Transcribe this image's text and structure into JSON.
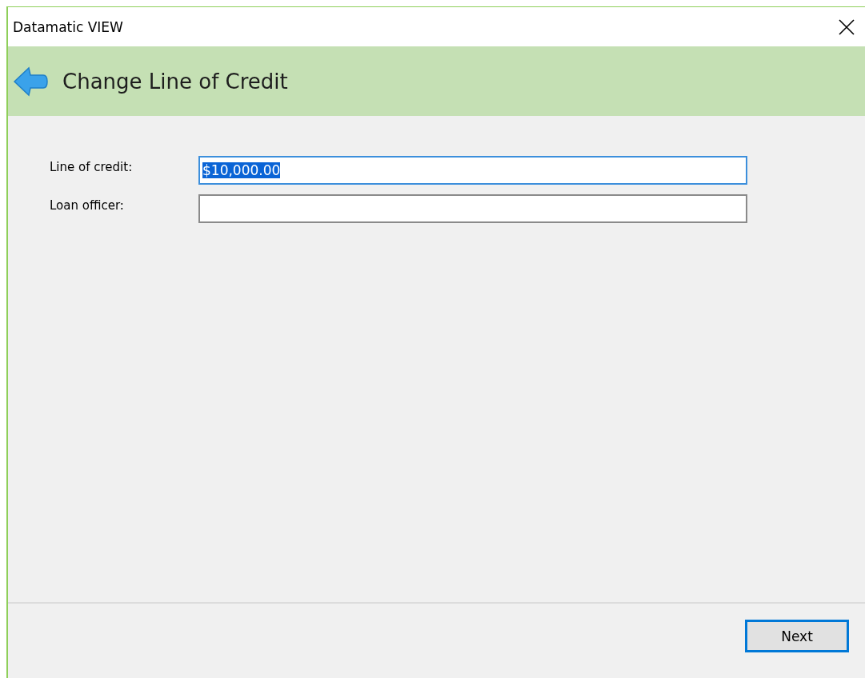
{
  "window": {
    "title": "Datamatic VIEW"
  },
  "header": {
    "title": "Change Line of Credit"
  },
  "fields": [
    {
      "label": "Line of credit:",
      "value": "$10,000.00",
      "focused": true
    },
    {
      "label": "Loan officer:",
      "focused": false
    }
  ],
  "buttons": [
    {
      "label": "Next",
      "default": true
    }
  ]
}
